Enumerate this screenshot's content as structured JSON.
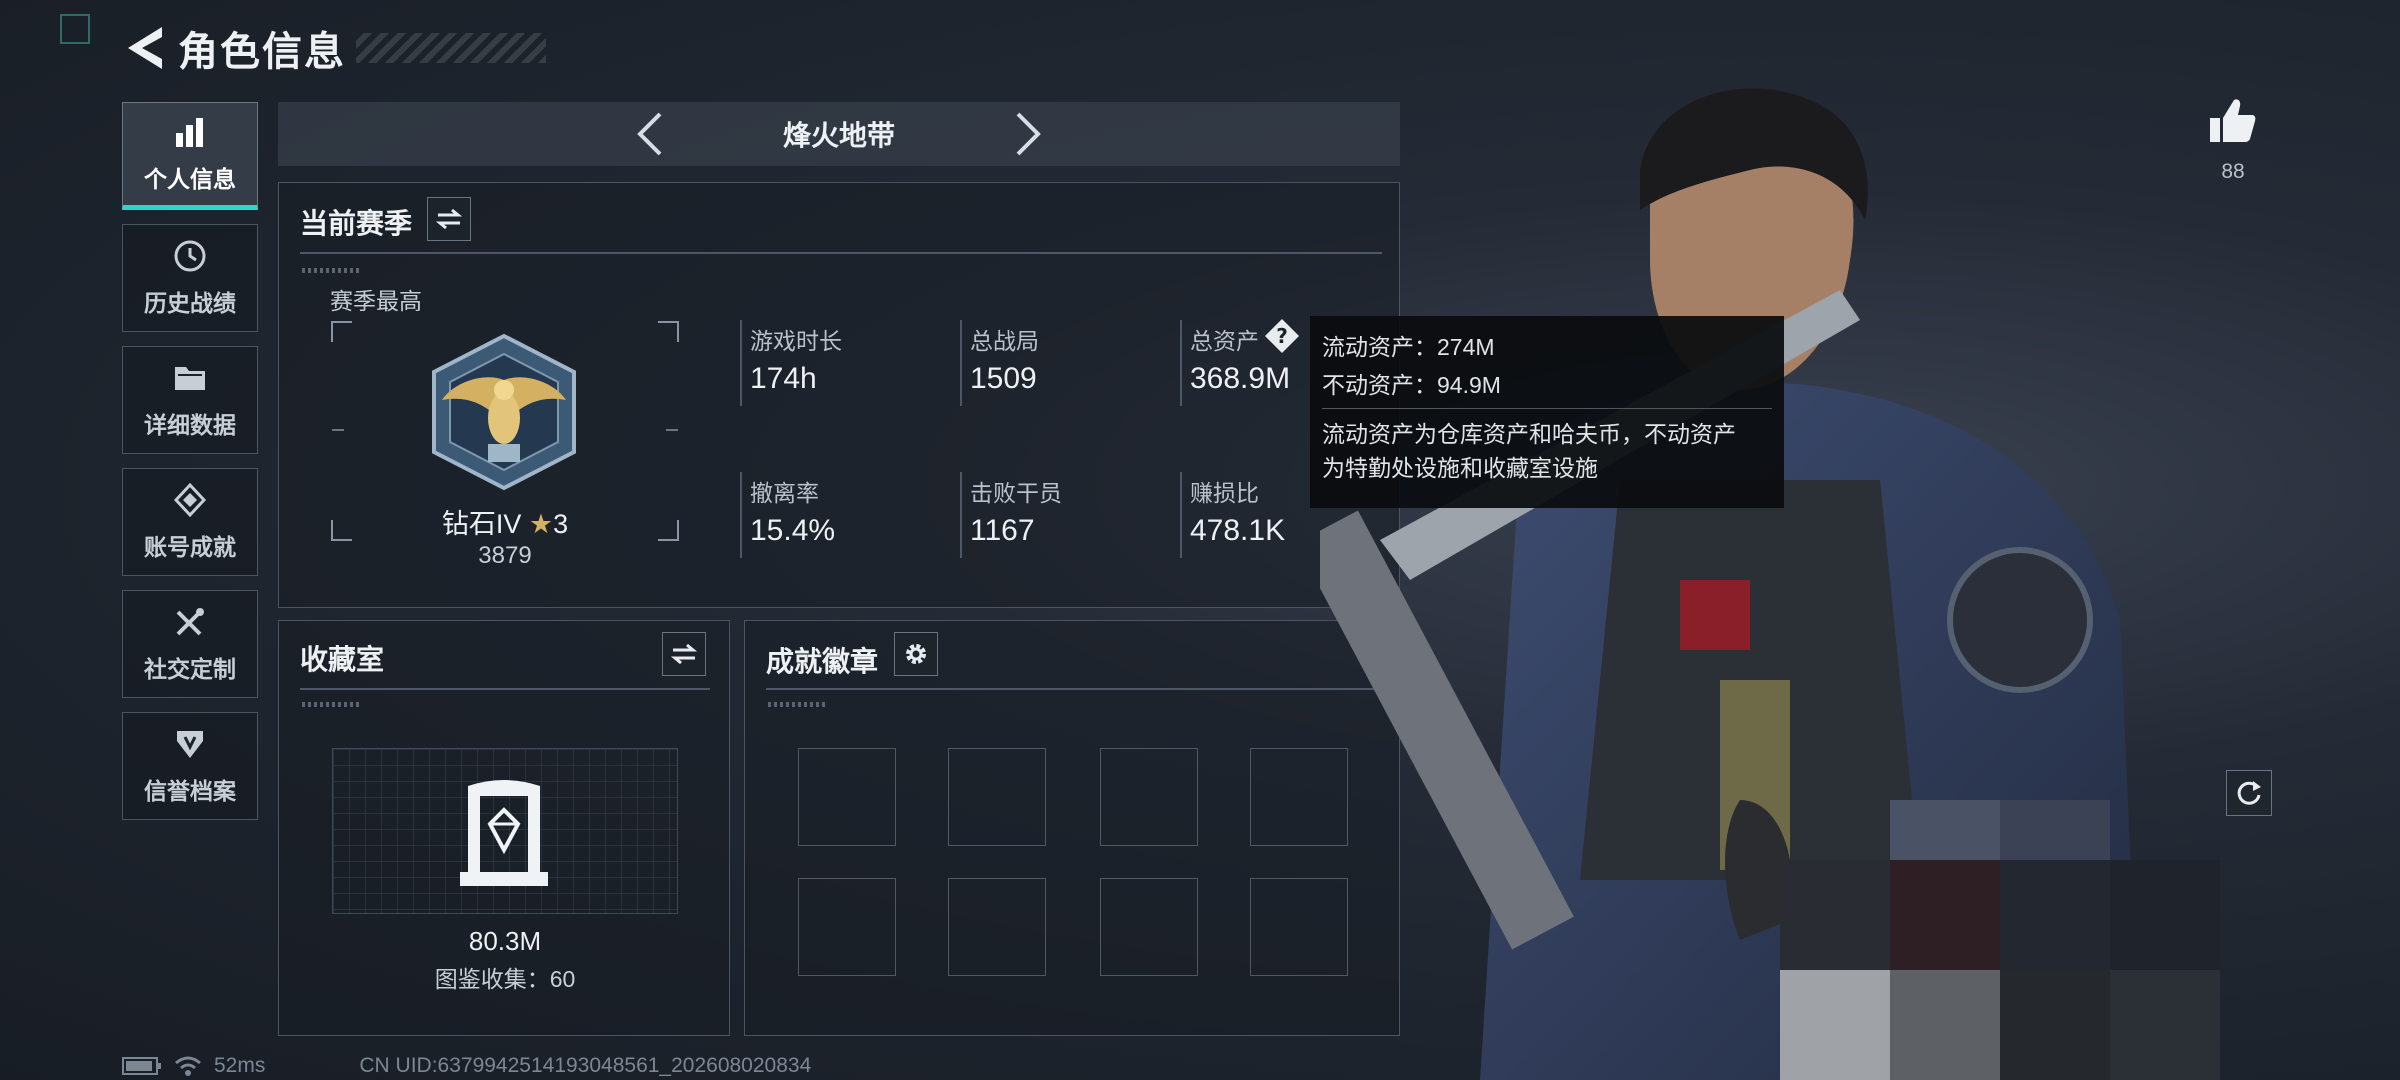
{
  "header": {
    "title": "角色信息"
  },
  "nav": {
    "items": [
      {
        "label": "个人信息",
        "icon": "bar-chart-icon",
        "active": true
      },
      {
        "label": "历史战绩",
        "icon": "history-icon",
        "active": false
      },
      {
        "label": "详细数据",
        "icon": "folder-icon",
        "active": false
      },
      {
        "label": "账号成就",
        "icon": "achievement-icon",
        "active": false
      },
      {
        "label": "社交定制",
        "icon": "tools-icon",
        "active": false
      },
      {
        "label": "信誉档案",
        "icon": "shield-icon",
        "active": false
      }
    ]
  },
  "mode": {
    "title": "烽火地带"
  },
  "season": {
    "title": "当前赛季",
    "best_label": "赛季最高",
    "rank_name": "钻石IV",
    "rank_stars": "3",
    "rank_score": "3879",
    "stats": [
      {
        "label": "游戏时长",
        "value": "174h"
      },
      {
        "label": "总战局",
        "value": "1509"
      },
      {
        "label": "总资产",
        "value": "368.9M"
      },
      {
        "label": "撤离率",
        "value": "15.4%"
      },
      {
        "label": "击败干员",
        "value": "1167"
      },
      {
        "label": "赚损比",
        "value": "478.1K"
      }
    ]
  },
  "tooltip": {
    "line1": "流动资产：274M",
    "line2": "不动资产：94.9M",
    "desc_line1": "流动资产为仓库资产和哈夫币，不动资产",
    "desc_line2": "为特勤处设施和收藏室设施"
  },
  "collection": {
    "title": "收藏室",
    "value": "80.3M",
    "collect_label": "图鉴收集：60"
  },
  "badges": {
    "title": "成就徽章",
    "slot_count": 8
  },
  "likes": {
    "count": "88"
  },
  "status_bar": {
    "ping": "52ms",
    "uid": "CN UID:6379942514193048561_202608020834"
  },
  "colors": {
    "accent": "#2bd7c7",
    "bg": "#1d232c",
    "panel_border": "#4a5463",
    "gold": "#d4b062"
  }
}
